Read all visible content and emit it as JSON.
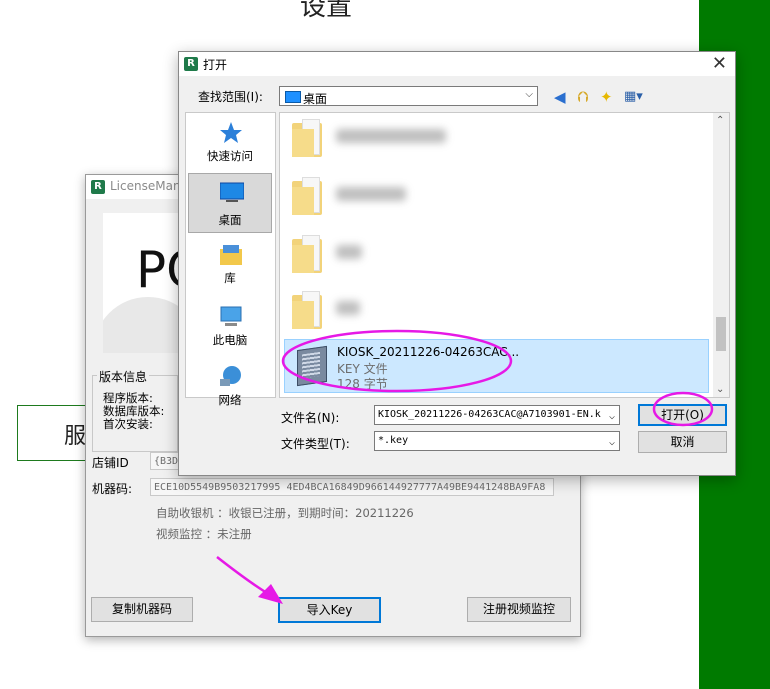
{
  "colors": {
    "green_bar": "#007a00",
    "annotation": "#e619e6",
    "accent_blue": "#0078d7",
    "app_icon": "#1f7a4a"
  },
  "background": {
    "title": "设置",
    "box_text": "服"
  },
  "license_manager": {
    "title": "LicenseMana",
    "logo_text": "PC",
    "version_group": {
      "legend": "版本信息",
      "lines": [
        "程序版本:",
        "数据库版本:",
        "首次安装:"
      ]
    },
    "store_id_label": "店铺ID",
    "store_id_value": "{B3D",
    "machine_code_label": "机器码:",
    "machine_code_value": "ECE10D5549B9503217995 4ED4BCA16849D966144927777A49BE9441248BA9FA8",
    "status_lines": [
      "自助收银机 ：收银已注册，到期时间：20211226",
      "视频监控 ：未注册"
    ],
    "buttons": {
      "copy_machine_code": "复制机器码",
      "import_key": "导入Key",
      "register_video": "注册视频监控"
    }
  },
  "open_dialog": {
    "title": "打开",
    "close_icon": "close-icon",
    "look_in_label": "查找范围(I):",
    "look_in_value": "桌面",
    "places": [
      {
        "label": "快速访问",
        "icon": "star-icon"
      },
      {
        "label": "桌面",
        "icon": "desktop-icon",
        "selected": true
      },
      {
        "label": "库",
        "icon": "library-icon"
      },
      {
        "label": "此电脑",
        "icon": "computer-icon"
      },
      {
        "label": "网络",
        "icon": "network-icon"
      }
    ],
    "file": {
      "name": "KIOSK_20211226-04263CAC...",
      "type": "KEY 文件",
      "size": "128 字节"
    },
    "file_name_label": "文件名(N):",
    "file_name_value": "KIOSK_20211226-04263CAC@A7103901-EN.k",
    "file_type_label": "文件类型(T):",
    "file_type_value": "*.key",
    "open_button": "打开(O)",
    "cancel_button": "取消"
  }
}
